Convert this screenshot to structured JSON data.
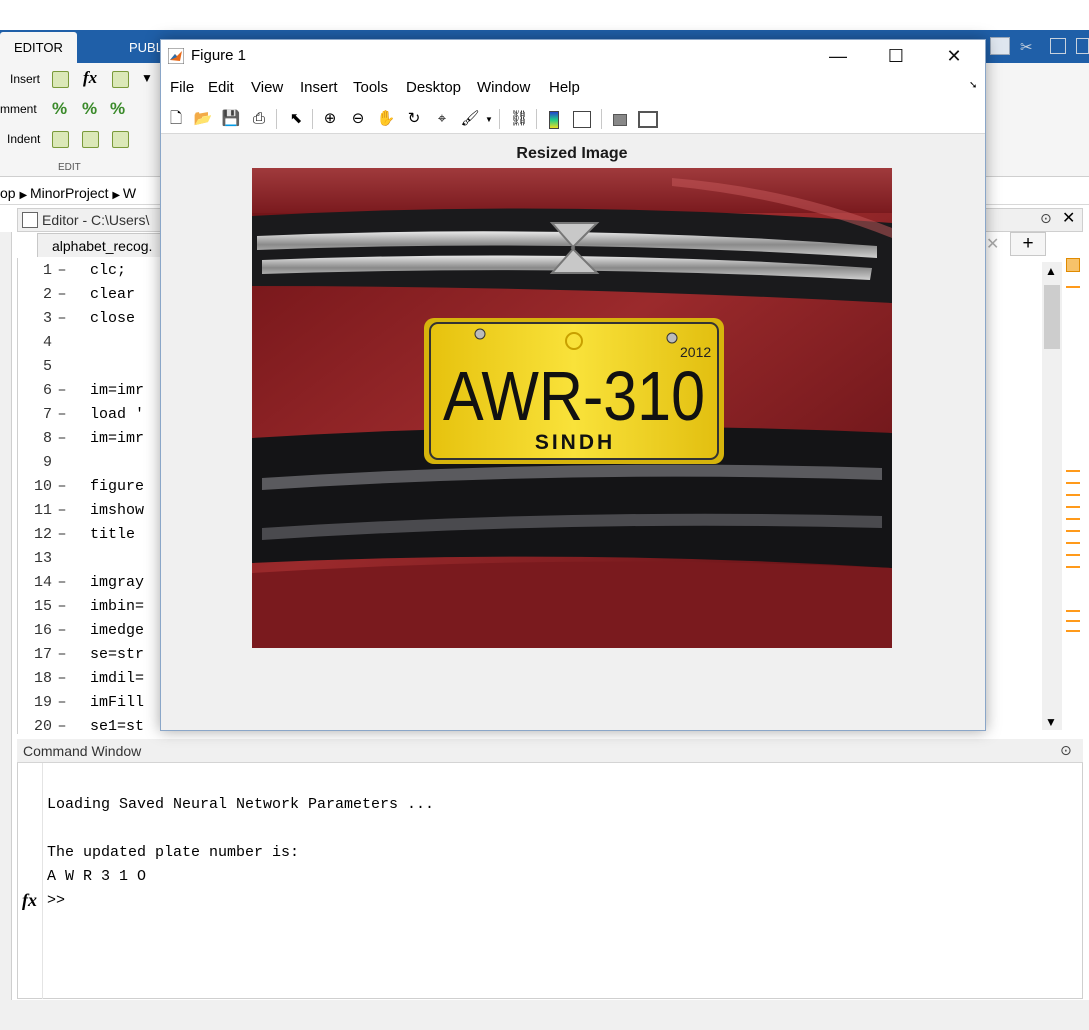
{
  "toolstrip": {
    "tabs": [
      {
        "label": "EDITOR"
      },
      {
        "label": "PUBL"
      }
    ],
    "edit_tools": {
      "insert_label": "Insert",
      "comment_label": "mment",
      "indent_label": "Indent",
      "section_label": "EDIT"
    }
  },
  "breadcrumb": {
    "items": [
      "op",
      "MinorProject",
      "W"
    ]
  },
  "editor": {
    "header_title": "Editor - C:\\Users\\",
    "file_tab": "alphabet_recog.",
    "lines": [
      {
        "num": "1",
        "dash": "–",
        "code": "  clc;"
      },
      {
        "num": "2",
        "dash": "–",
        "code": "  clear"
      },
      {
        "num": "3",
        "dash": "–",
        "code": "  close"
      },
      {
        "num": "4",
        "dash": "",
        "code": ""
      },
      {
        "num": "5",
        "dash": "",
        "code": ""
      },
      {
        "num": "6",
        "dash": "–",
        "code": "  im=imr"
      },
      {
        "num": "7",
        "dash": "–",
        "code": "  load '"
      },
      {
        "num": "8",
        "dash": "–",
        "code": "  im=imr"
      },
      {
        "num": "9",
        "dash": "",
        "code": ""
      },
      {
        "num": "10",
        "dash": "–",
        "code": "  figure"
      },
      {
        "num": "11",
        "dash": "–",
        "code": "  imshow"
      },
      {
        "num": "12",
        "dash": "–",
        "code": "  title"
      },
      {
        "num": "13",
        "dash": "",
        "code": ""
      },
      {
        "num": "14",
        "dash": "–",
        "code": "  imgray"
      },
      {
        "num": "15",
        "dash": "–",
        "code": "  imbin="
      },
      {
        "num": "16",
        "dash": "–",
        "code": "  imedge"
      },
      {
        "num": "17",
        "dash": "–",
        "code": "  se=str"
      },
      {
        "num": "18",
        "dash": "–",
        "code": "  imdil="
      },
      {
        "num": "19",
        "dash": "–",
        "code": "  imFill"
      },
      {
        "num": "20",
        "dash": "–",
        "code": "  se1=st"
      }
    ]
  },
  "command_window": {
    "title": "Command Window",
    "lines": [
      "Loading Saved Neural Network Parameters ...",
      "The updated plate number is:",
      "A W R 3 1 O"
    ],
    "prompt": ">>",
    "fx_label": "fx"
  },
  "figure": {
    "window_title": "Figure 1",
    "menu": [
      "File",
      "Edit",
      "View",
      "Insert",
      "Tools",
      "Desktop",
      "Window",
      "Help"
    ],
    "plot_title": "Resized Image",
    "plate": {
      "text": "AWR-310",
      "region": "SINDH",
      "year": "2012"
    }
  },
  "colors": {
    "toolstrip_blue": "#1f5fa8",
    "car_red": "#8a1a1e",
    "plate_yellow": "#f2d21c"
  }
}
